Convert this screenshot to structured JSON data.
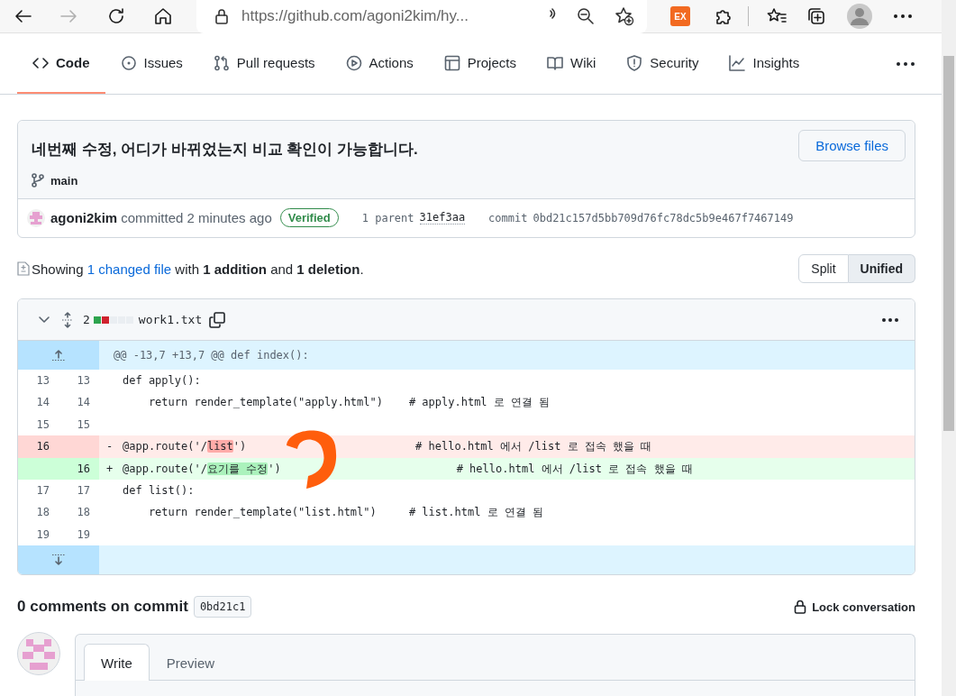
{
  "browser": {
    "url": "https://github.com/agoni2kim/hy...",
    "toolbar": [
      {
        "kind": "back",
        "disabled": false
      },
      {
        "kind": "forward",
        "disabled": true
      },
      {
        "kind": "refresh",
        "disabled": false
      },
      {
        "kind": "home",
        "disabled": false
      }
    ],
    "extension_label": "EX"
  },
  "repo_nav": {
    "tabs": [
      {
        "label": "Code",
        "selected": true
      },
      {
        "label": "Issues",
        "selected": false
      },
      {
        "label": "Pull requests",
        "selected": false
      },
      {
        "label": "Actions",
        "selected": false
      },
      {
        "label": "Projects",
        "selected": false
      },
      {
        "label": "Wiki",
        "selected": false
      },
      {
        "label": "Security",
        "selected": false
      },
      {
        "label": "Insights",
        "selected": false
      }
    ]
  },
  "commit": {
    "title": "네번째 수정, 어디가 바뀌었는지 비교 확인이 가능합니다.",
    "browse_button": "Browse files",
    "branch": "main",
    "author": "agoni2kim",
    "committed": "committed 2 minutes ago",
    "badge": "Verified",
    "parent_label": "1 parent",
    "parent_sha": "31ef3aa",
    "commit_label": "commit",
    "sha": "0bd21c157d5bb709d76fc78dc5b9e467f7467149"
  },
  "summary": {
    "prefix": "Showing",
    "link": "1 changed file",
    "suffix": "with **1 addition** and **1 deletion**."
  },
  "view_toggle": [
    {
      "label": "Split",
      "selected": false
    },
    {
      "label": "Unified",
      "selected": true
    }
  ],
  "file": {
    "expanded": true,
    "changes": "2",
    "diffstat": [
      {
        "color": "#2da44e"
      },
      {
        "color": "#cf222e"
      },
      {
        "color": "#eaeef2"
      },
      {
        "color": "#eaeef2"
      },
      {
        "color": "#eaeef2"
      }
    ],
    "name": "work1.txt",
    "hunk": "@@ -13,7 +13,7 @@ def index():",
    "lines": [
      {
        "kind": "context",
        "old": "13",
        "new": "13",
        "segments": [
          {
            "text": "def apply():"
          }
        ]
      },
      {
        "kind": "context",
        "old": "14",
        "new": "14",
        "segments": [
          {
            "text": "    return render_template(\"apply.html\")    # apply.html 로 연결 됨"
          }
        ]
      },
      {
        "kind": "context",
        "old": "15",
        "new": "15"
      },
      {
        "kind": "deletion",
        "old": "16",
        "sign": "-",
        "segments": [
          {
            "text": "@app.route('/"
          },
          {
            "text": "list",
            "highlight": true
          },
          {
            "text": "')                          # hello.html 에서 /list 로 접속 했을 때"
          }
        ]
      },
      {
        "kind": "addition",
        "new": "16",
        "sign": "+",
        "segments": [
          {
            "text": "@app.route('/"
          },
          {
            "text": "요기를 수정",
            "highlight": true
          },
          {
            "text": "')                           # hello.html 에서 /list 로 접속 했을 때"
          }
        ]
      },
      {
        "kind": "context",
        "old": "17",
        "new": "17",
        "segments": [
          {
            "text": "def list():"
          }
        ]
      },
      {
        "kind": "context",
        "old": "18",
        "new": "18",
        "segments": [
          {
            "text": "    return render_template(\"list.html\")     # list.html 로 연결 됨"
          }
        ]
      },
      {
        "kind": "context",
        "old": "19",
        "new": "19"
      }
    ]
  },
  "comments": {
    "heading": "0 comments on commit",
    "sha": "0bd21c1",
    "lock": "Lock conversation",
    "tabs": [
      {
        "label": "Write",
        "selected": true
      },
      {
        "label": "Preview",
        "selected": false
      }
    ]
  }
}
